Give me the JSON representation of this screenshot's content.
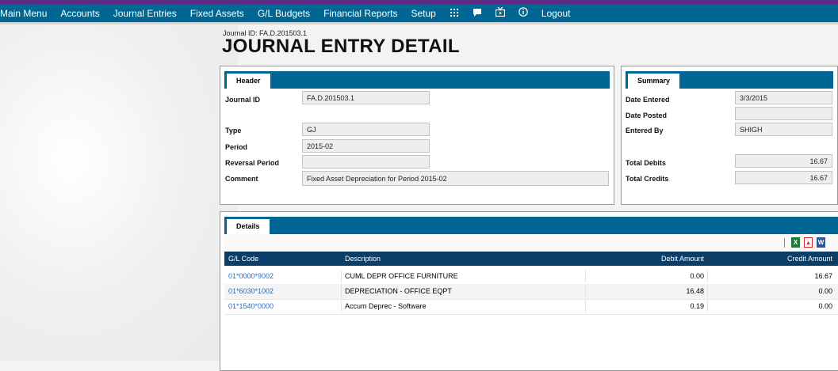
{
  "nav": {
    "items": [
      "Main Menu",
      "Accounts",
      "Journal Entries",
      "Fixed Assets",
      "G/L Budgets",
      "Financial Reports",
      "Setup"
    ],
    "icons": [
      "grid-icon",
      "chat-icon",
      "tv-icon",
      "info-icon"
    ],
    "logout": "Logout"
  },
  "page": {
    "journal_id_label": "Journal ID: FA.D.201503.1",
    "title": "JOURNAL ENTRY DETAIL"
  },
  "header": {
    "tab": "Header",
    "fields": {
      "journal_id": {
        "label": "Journal ID",
        "value": "FA.D.201503.1"
      },
      "type": {
        "label": "Type",
        "value": "GJ"
      },
      "period": {
        "label": "Period",
        "value": "2015-02"
      },
      "reversal_period": {
        "label": "Reversal Period",
        "value": ""
      },
      "comment": {
        "label": "Comment",
        "value": "Fixed Asset Depreciation for Period 2015-02"
      }
    }
  },
  "summary": {
    "tab": "Summary",
    "fields": {
      "date_entered": {
        "label": "Date Entered",
        "value": "3/3/2015"
      },
      "date_posted": {
        "label": "Date Posted",
        "value": ""
      },
      "entered_by": {
        "label": "Entered By",
        "value": "SHIGH"
      },
      "total_debits": {
        "label": "Total Debits",
        "value": "16.67"
      },
      "total_credits": {
        "label": "Total Credits",
        "value": "16.67"
      }
    }
  },
  "details": {
    "tab": "Details",
    "export_icons": [
      "excel-icon",
      "pdf-icon",
      "word-icon"
    ],
    "columns": [
      "G/L Code",
      "Description",
      "Debit Amount",
      "Credit Amount"
    ],
    "rows": [
      {
        "gl_code": "01*0000*9002",
        "description": "CUML DEPR OFFICE FURNITURE",
        "debit": "0.00",
        "credit": "16.67"
      },
      {
        "gl_code": "01*6030*1002",
        "description": "DEPRECIATION - OFFICE EQPT",
        "debit": "16.48",
        "credit": "0.00"
      },
      {
        "gl_code": "01*1540*0000",
        "description": "Accum Deprec - Software",
        "debit": "0.19",
        "credit": "0.00"
      }
    ]
  }
}
